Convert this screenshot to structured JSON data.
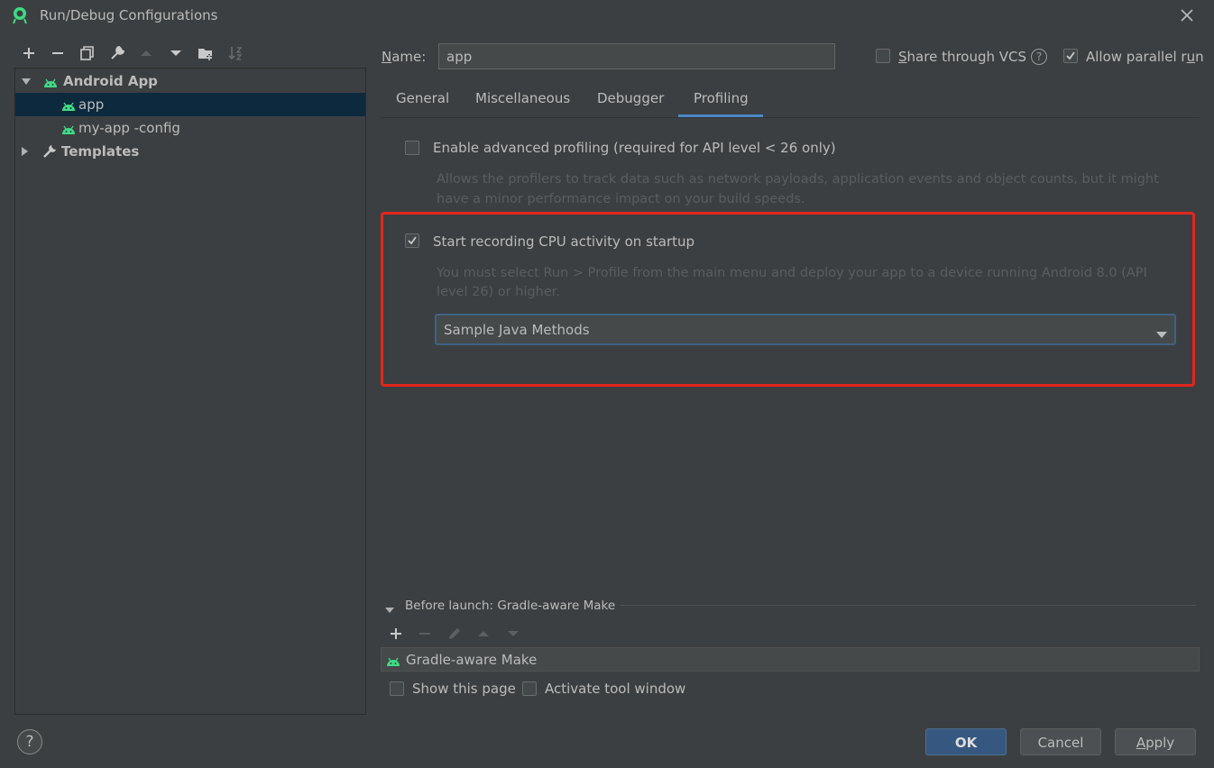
{
  "window": {
    "title": "Run/Debug Configurations"
  },
  "tree": {
    "items": [
      {
        "label": "Android App",
        "expanded": true,
        "bold": true
      },
      {
        "label": "app",
        "selected": true
      },
      {
        "label": "my-app -config"
      },
      {
        "label": "Templates",
        "expanded": false,
        "bold": true
      }
    ]
  },
  "name_field": {
    "label": "Name:",
    "value": "app"
  },
  "share_vcs": {
    "label": "Share through VCS",
    "checked": false
  },
  "allow_parallel": {
    "label": "Allow parallel run",
    "checked": true
  },
  "tabs": [
    {
      "label": "General"
    },
    {
      "label": "Miscellaneous"
    },
    {
      "label": "Debugger"
    },
    {
      "label": "Profiling",
      "active": true
    }
  ],
  "profiling": {
    "advanced": {
      "label": "Enable advanced profiling (required for API level < 26 only)",
      "checked": false,
      "description_line1": "Allows the profilers to track data such as network payloads, application events and object counts, but it might",
      "description_line2": "have a minor performance impact on your build speeds."
    },
    "cpu": {
      "label": "Start recording CPU activity on startup",
      "checked": true,
      "description_line1": "You must select Run > Profile from the main menu and deploy your app to a device running Android 8.0 (API",
      "description_line2": "level 26) or higher.",
      "selected_method": "Sample Java Methods"
    }
  },
  "before_launch": {
    "label": "Before launch: Gradle-aware Make",
    "items": [
      {
        "label": "Gradle-aware Make"
      }
    ],
    "show_this_page": {
      "label": "Show this page",
      "checked": false
    },
    "activate_tool_window": {
      "label": "Activate tool window",
      "checked": false
    }
  },
  "buttons": {
    "help": "?",
    "ok": "OK",
    "cancel": "Cancel",
    "apply": "Apply"
  },
  "colors": {
    "background": "#3c3f41",
    "selection": "#0d293e",
    "accent": "#4a88c7",
    "android_green": "#3ddc84",
    "highlight_red": "#e2271c",
    "ok_button": "#365880"
  }
}
